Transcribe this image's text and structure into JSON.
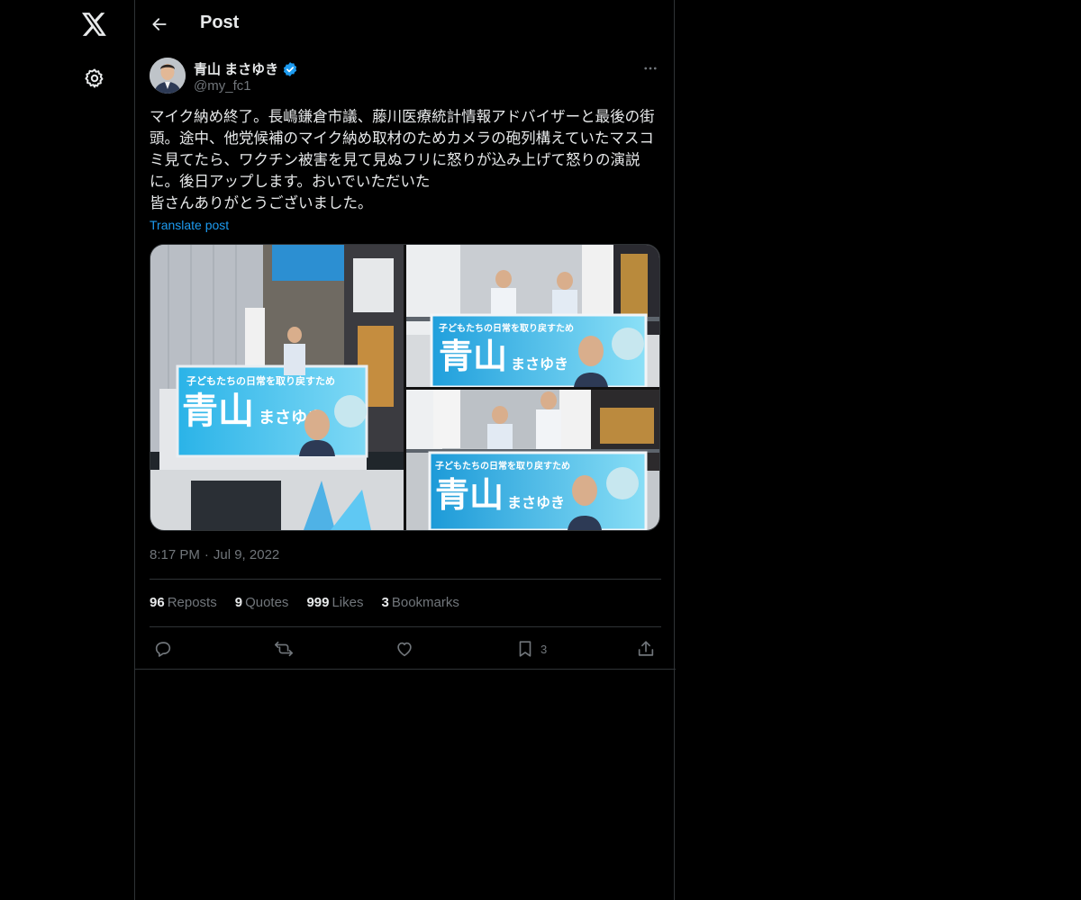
{
  "nav": {
    "logo_icon": "x-logo-icon",
    "settings_icon": "gear-icon"
  },
  "header": {
    "back_icon": "arrow-left-icon",
    "title": "Post"
  },
  "author": {
    "name": "青山 まさゆき",
    "handle": "@my_fc1",
    "verified_icon": "verified-badge-icon",
    "verified_color": "#1d9bf0"
  },
  "post": {
    "text": "マイク納め終了。長嶋鎌倉市議、藤川医療統計情報アドバイザーと最後の街頭。途中、他党候補のマイク納め取材のためカメラの砲列構えていたマスコミ見てたら、ワクチン被害を見て見ぬフリに怒りが込み上げて怒りの演説に。後日アップします。おいでいただいた\n皆さんありがとうございました。",
    "translate_label": "Translate post",
    "banner_text_large": "青山",
    "banner_text_kana": "まさゆき",
    "banner_slogan": "子どもたちの日常を取り戻すため",
    "time": "8:17 PM",
    "separator": "·",
    "date": "Jul 9, 2022"
  },
  "stats": {
    "reposts_count": "96",
    "reposts_label": "Reposts",
    "quotes_count": "9",
    "quotes_label": "Quotes",
    "likes_count": "999",
    "likes_label": "Likes",
    "bookmarks_count": "3",
    "bookmarks_label": "Bookmarks"
  },
  "actions": {
    "bookmark_count": "3"
  },
  "colors": {
    "background": "#000000",
    "text": "#e7e9ea",
    "muted": "#71767b",
    "accent": "#1d9bf0",
    "border": "#2f3336"
  }
}
